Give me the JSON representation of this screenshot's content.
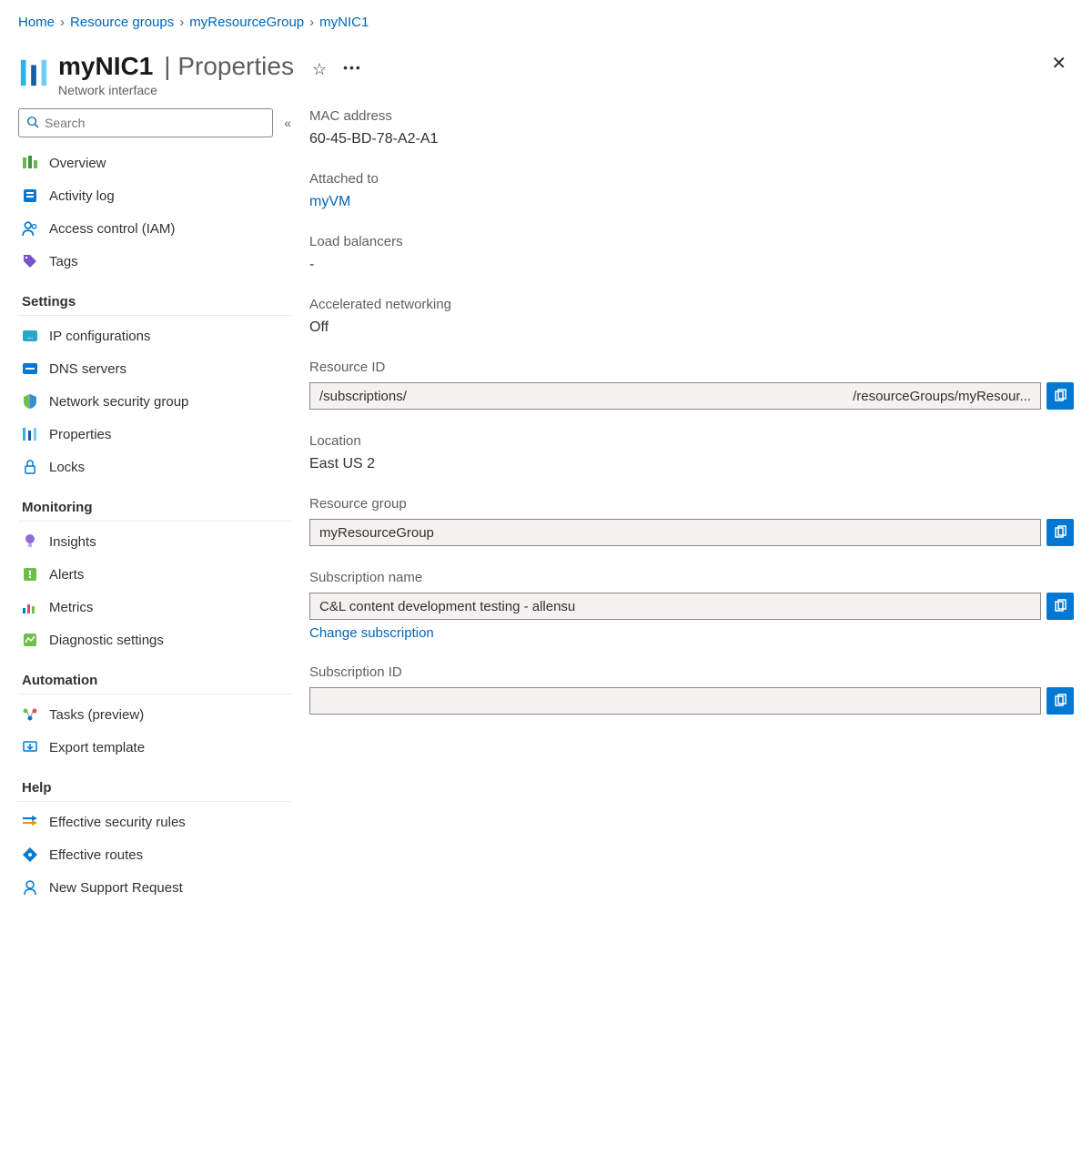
{
  "breadcrumb": {
    "home": "Home",
    "rg": "Resource groups",
    "group": "myResourceGroup",
    "resource": "myNIC1"
  },
  "header": {
    "title": "myNIC1",
    "section": "Properties",
    "subtitle": "Network interface"
  },
  "search": {
    "placeholder": "Search"
  },
  "nav": {
    "overview": "Overview",
    "activity_log": "Activity log",
    "iam": "Access control (IAM)",
    "tags": "Tags",
    "sections": {
      "settings": "Settings",
      "monitoring": "Monitoring",
      "automation": "Automation",
      "help": "Help"
    },
    "settings": {
      "ipconfig": "IP configurations",
      "dns": "DNS servers",
      "nsg": "Network security group",
      "properties": "Properties",
      "locks": "Locks"
    },
    "monitoring": {
      "insights": "Insights",
      "alerts": "Alerts",
      "metrics": "Metrics",
      "diag": "Diagnostic settings"
    },
    "automation": {
      "tasks": "Tasks (preview)",
      "export": "Export template"
    },
    "help": {
      "eff_sec": "Effective security rules",
      "eff_routes": "Effective routes",
      "support": "New Support Request"
    }
  },
  "props": {
    "mac_label": "MAC address",
    "mac_value": "60-45-BD-78-A2-A1",
    "attached_label": "Attached to",
    "attached_value": "myVM",
    "lb_label": "Load balancers",
    "lb_value": "-",
    "accel_label": "Accelerated networking",
    "accel_value": "Off",
    "resourceid_label": "Resource ID",
    "resourceid_left": "/subscriptions/",
    "resourceid_right": "/resourceGroups/myResour...",
    "location_label": "Location",
    "location_value": "East US 2",
    "rg_label": "Resource group",
    "rg_value": "myResourceGroup",
    "sub_label": "Subscription name",
    "sub_value": "C&L content development testing - allensu",
    "change_sub": "Change subscription",
    "subid_label": "Subscription ID",
    "subid_value": ""
  }
}
